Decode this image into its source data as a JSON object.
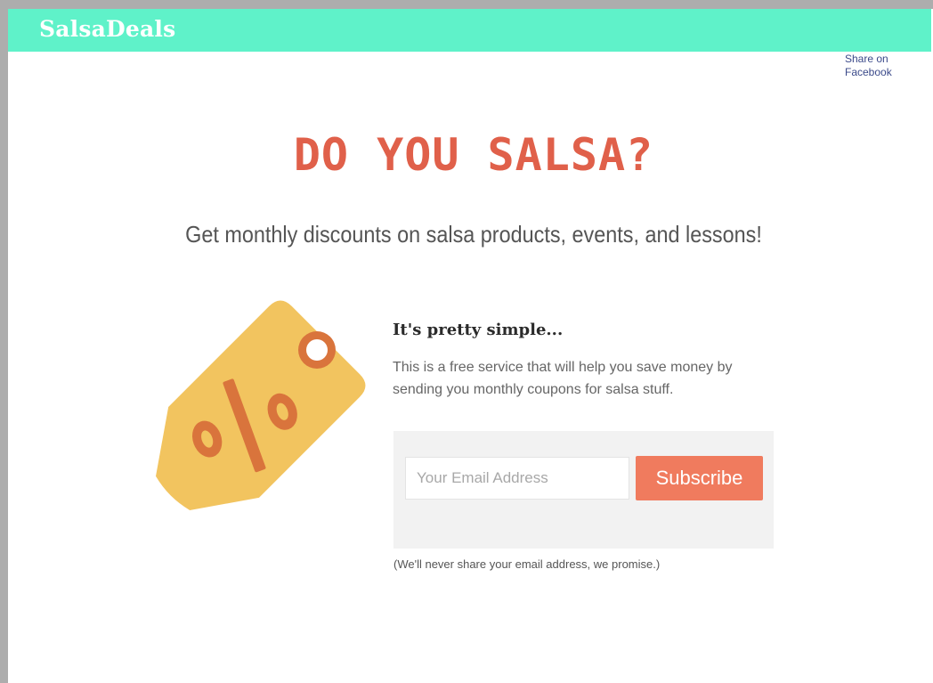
{
  "header": {
    "brand": "SalsaDeals",
    "share_link": "Share on Facebook"
  },
  "hero": {
    "headline": "DO YOU SALSA?",
    "subheadline": "Get monthly discounts on salsa products, events, and lessons!"
  },
  "illustration": {
    "icon": "discount-tag-icon",
    "tag_color": "#f2c45f",
    "accent_color": "#d9743c"
  },
  "content": {
    "title": "It's pretty simple...",
    "description": "This is a free service that will help you save money by sending you monthly coupons for salsa stuff."
  },
  "form": {
    "email_placeholder": "Your Email Address",
    "email_value": "",
    "subscribe_label": "Subscribe",
    "privacy_note": "(We'll never share your email address, we promise.)"
  },
  "colors": {
    "header_bar": "#5ff2c9",
    "headline": "#e0604a",
    "button": "#f07b5e",
    "form_panel": "#f2f2f2"
  }
}
